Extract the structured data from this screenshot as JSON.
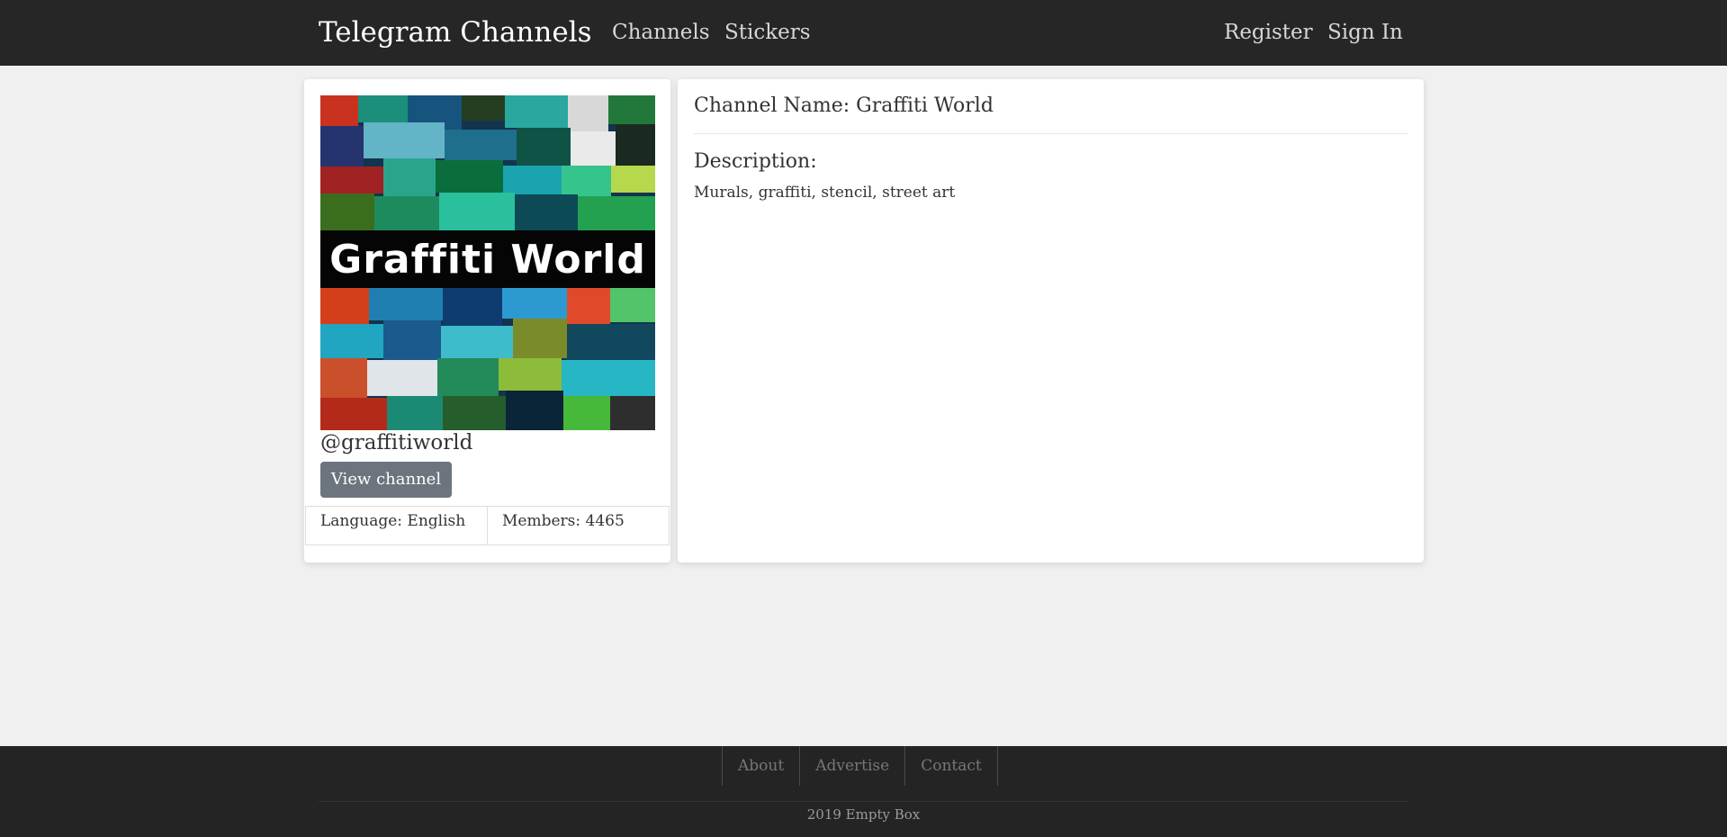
{
  "navbar": {
    "brand": "Telegram Channels",
    "links": [
      "Channels",
      "Stickers"
    ],
    "auth_links": [
      "Register",
      "Sign In"
    ]
  },
  "channel": {
    "image_text": "Graffiti World",
    "handle": "@graffitiworld",
    "view_button": "View channel",
    "language": "Language: English",
    "members": "Members: 4465",
    "name": "Channel Name: Graffiti World",
    "description_heading": "Description:",
    "description": "Murals, graffiti, stencil, street art"
  },
  "footer": {
    "links": [
      "About",
      "Advertise",
      "Contact"
    ],
    "copyright": "2019 Empty Box"
  },
  "colors": {
    "navbar_bg": "#262626",
    "page_bg": "#f0f0f0",
    "button_bg": "#6c757d",
    "footer_bg": "#242424"
  }
}
